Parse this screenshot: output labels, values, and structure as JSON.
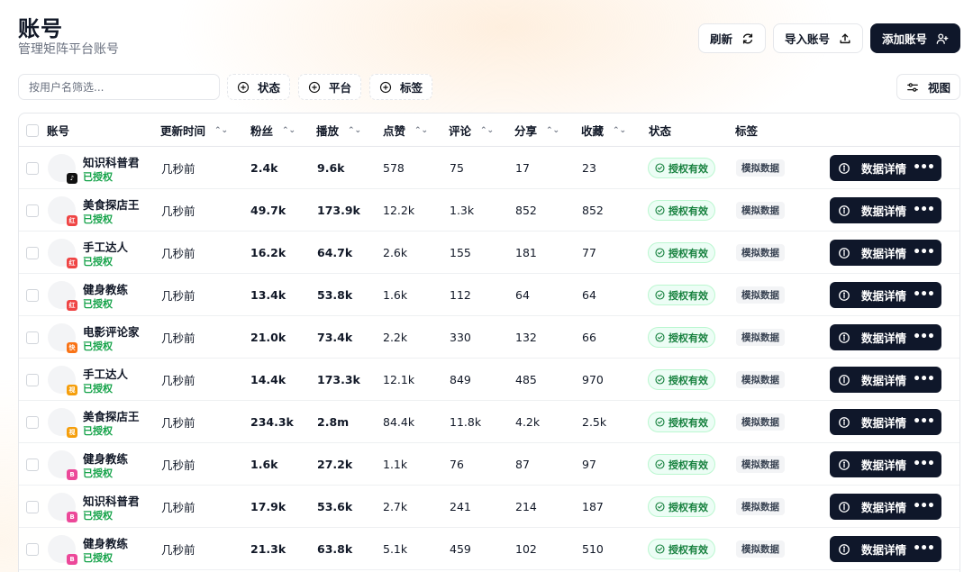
{
  "header": {
    "title": "账号",
    "subtitle": "管理矩阵平台账号",
    "refresh_label": "刷新",
    "import_label": "导入账号",
    "add_label": "添加账号"
  },
  "filters": {
    "search_placeholder": "按用户名筛选...",
    "status_label": "状态",
    "platform_label": "平台",
    "tag_label": "标签",
    "view_label": "视图"
  },
  "table": {
    "columns": {
      "account": "账号",
      "updated": "更新时间",
      "fans": "粉丝",
      "plays": "播放",
      "likes": "点赞",
      "comments": "评论",
      "shares": "分享",
      "favorites": "收藏",
      "status": "状态",
      "tags": "标签"
    },
    "rows": [
      {
        "name": "知识科普君",
        "auth": "已授权",
        "platform_icon": "douyin-icon",
        "platform_color": "#111111",
        "updated": "几秒前",
        "fans": "2.4k",
        "plays": "9.6k",
        "likes": "578",
        "comments": "75",
        "shares": "17",
        "favorites": "23",
        "status": "授权有效",
        "tag": "模拟数据",
        "detail": "数据详情"
      },
      {
        "name": "美食探店王",
        "auth": "已授权",
        "platform_icon": "xiaohongshu-icon",
        "platform_color": "#ef4444",
        "updated": "几秒前",
        "fans": "49.7k",
        "plays": "173.9k",
        "likes": "12.2k",
        "comments": "1.3k",
        "shares": "852",
        "favorites": "852",
        "status": "授权有效",
        "tag": "模拟数据",
        "detail": "数据详情"
      },
      {
        "name": "手工达人",
        "auth": "已授权",
        "platform_icon": "xiaohongshu-icon",
        "platform_color": "#ef4444",
        "updated": "几秒前",
        "fans": "16.2k",
        "plays": "64.7k",
        "likes": "2.6k",
        "comments": "155",
        "shares": "181",
        "favorites": "77",
        "status": "授权有效",
        "tag": "模拟数据",
        "detail": "数据详情"
      },
      {
        "name": "健身教练",
        "auth": "已授权",
        "platform_icon": "xiaohongshu-icon",
        "platform_color": "#ef4444",
        "updated": "几秒前",
        "fans": "13.4k",
        "plays": "53.8k",
        "likes": "1.6k",
        "comments": "112",
        "shares": "64",
        "favorites": "64",
        "status": "授权有效",
        "tag": "模拟数据",
        "detail": "数据详情"
      },
      {
        "name": "电影评论家",
        "auth": "已授权",
        "platform_icon": "kuaishou-icon",
        "platform_color": "#f97316",
        "updated": "几秒前",
        "fans": "21.0k",
        "plays": "73.4k",
        "likes": "2.2k",
        "comments": "330",
        "shares": "132",
        "favorites": "66",
        "status": "授权有效",
        "tag": "模拟数据",
        "detail": "数据详情"
      },
      {
        "name": "手工达人",
        "auth": "已授权",
        "platform_icon": "channels-icon",
        "platform_color": "#f59e0b",
        "updated": "几秒前",
        "fans": "14.4k",
        "plays": "173.3k",
        "likes": "12.1k",
        "comments": "849",
        "shares": "485",
        "favorites": "970",
        "status": "授权有效",
        "tag": "模拟数据",
        "detail": "数据详情"
      },
      {
        "name": "美食探店王",
        "auth": "已授权",
        "platform_icon": "channels-icon",
        "platform_color": "#f59e0b",
        "updated": "几秒前",
        "fans": "234.3k",
        "plays": "2.8m",
        "likes": "84.4k",
        "comments": "11.8k",
        "shares": "4.2k",
        "favorites": "2.5k",
        "status": "授权有效",
        "tag": "模拟数据",
        "detail": "数据详情"
      },
      {
        "name": "健身教练",
        "auth": "已授权",
        "platform_icon": "bilibili-icon",
        "platform_color": "#ec4899",
        "updated": "几秒前",
        "fans": "1.6k",
        "plays": "27.2k",
        "likes": "1.1k",
        "comments": "76",
        "shares": "87",
        "favorites": "97",
        "status": "授权有效",
        "tag": "模拟数据",
        "detail": "数据详情"
      },
      {
        "name": "知识科普君",
        "auth": "已授权",
        "platform_icon": "bilibili-icon",
        "platform_color": "#ec4899",
        "updated": "几秒前",
        "fans": "17.9k",
        "plays": "53.6k",
        "likes": "2.7k",
        "comments": "241",
        "shares": "214",
        "favorites": "187",
        "status": "授权有效",
        "tag": "模拟数据",
        "detail": "数据详情"
      },
      {
        "name": "健身教练",
        "auth": "已授权",
        "platform_icon": "bilibili-icon",
        "platform_color": "#ec4899",
        "updated": "几秒前",
        "fans": "21.3k",
        "plays": "63.8k",
        "likes": "5.1k",
        "comments": "459",
        "shares": "102",
        "favorites": "510",
        "status": "授权有效",
        "tag": "模拟数据",
        "detail": "数据详情"
      }
    ]
  },
  "colors": {
    "primary_dark": "#0f172a",
    "success": "#16a34a",
    "border": "#e5e7eb"
  }
}
